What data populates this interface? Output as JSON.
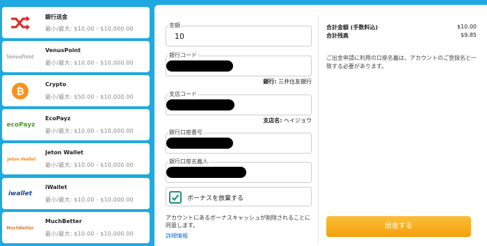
{
  "methods": [
    {
      "name": "銀行送金",
      "limit": "最小/最大: $10.00 - $10,000.00",
      "icon": "shuffle-icon"
    },
    {
      "name": "VenusPoint",
      "limit": "最小/最大: $10.00 - $10,000.00",
      "icon": "venuspoint-logo",
      "logo_text": "VenusPoint"
    },
    {
      "name": "Crypto",
      "limit": "最小/最大: $50.00 - $10,000.00",
      "icon": "bitcoin-icon"
    },
    {
      "name": "EcoPayz",
      "limit": "最小/最大: $10.00 - $10,000.00",
      "icon": "ecopayz-logo",
      "logo_text": "ecoPayz"
    },
    {
      "name": "Jeton Wallet",
      "limit": "最小/最大: $10.00 - $10,000.00",
      "icon": "jeton-logo",
      "logo_text": "Jeton Wallet"
    },
    {
      "name": "iWallet",
      "limit": "最小/最大: $10.00 - $10,000.00",
      "icon": "iwallet-logo",
      "logo_text": "iwallet"
    },
    {
      "name": "MuchBetter",
      "limit": "最小/最大: $10.00 - $10,000.00",
      "icon": "muchbetter-logo",
      "logo_text": "MuchBetter"
    }
  ],
  "form": {
    "amount_label": "金額",
    "amount_value": "10",
    "bank_code_label": "銀行コード",
    "bank_name_key": "銀行:",
    "bank_name_value": "三井住友銀行",
    "branch_code_label": "支店コード",
    "branch_name_key": "支店名:",
    "branch_name_value": "ヘイジョウ",
    "account_number_label": "銀行口座番号",
    "account_holder_label": "銀行口座名義人",
    "bonus_label": "ボーナスを放棄する",
    "bonus_checked": true,
    "note": "アカウントにあるボーナスキャッシュが削除されることに同意します。",
    "details_link": "詳細情報"
  },
  "summary": {
    "total_label": "合計金額 (手数料込)",
    "total_value": "$10.00",
    "balance_label": "合計残高",
    "balance_value": "$9.85",
    "note": "ご出金申請に利用の口座名義は、アカウントのご登録名と一致する必要があります。",
    "withdraw_button": "出金する"
  },
  "colors": {
    "background": "#1ea9e0",
    "accent_button": "#f4a00d",
    "check": "#1f8f6f",
    "link": "#1a73c9"
  }
}
